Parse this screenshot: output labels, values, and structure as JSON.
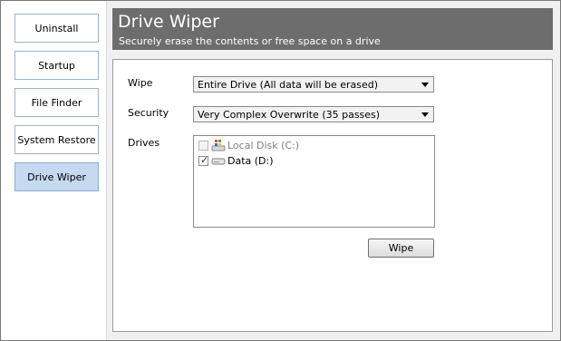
{
  "sidebar": {
    "items": [
      {
        "label": "Uninstall"
      },
      {
        "label": "Startup"
      },
      {
        "label": "File Finder"
      },
      {
        "label": "System Restore"
      },
      {
        "label": "Drive Wiper"
      }
    ]
  },
  "header": {
    "title": "Drive Wiper",
    "subtitle": "Securely erase the contents or free space on a drive"
  },
  "form": {
    "wipe_label": "Wipe",
    "wipe_value": "Entire Drive (All data will be erased)",
    "security_label": "Security",
    "security_value": "Very Complex Overwrite (35 passes)",
    "drives_label": "Drives",
    "drives": [
      {
        "label": "Local Disk (C:)",
        "checked": false,
        "enabled": false
      },
      {
        "label": "Data (D:)",
        "checked": true,
        "enabled": true
      }
    ],
    "wipe_button": "Wipe"
  }
}
